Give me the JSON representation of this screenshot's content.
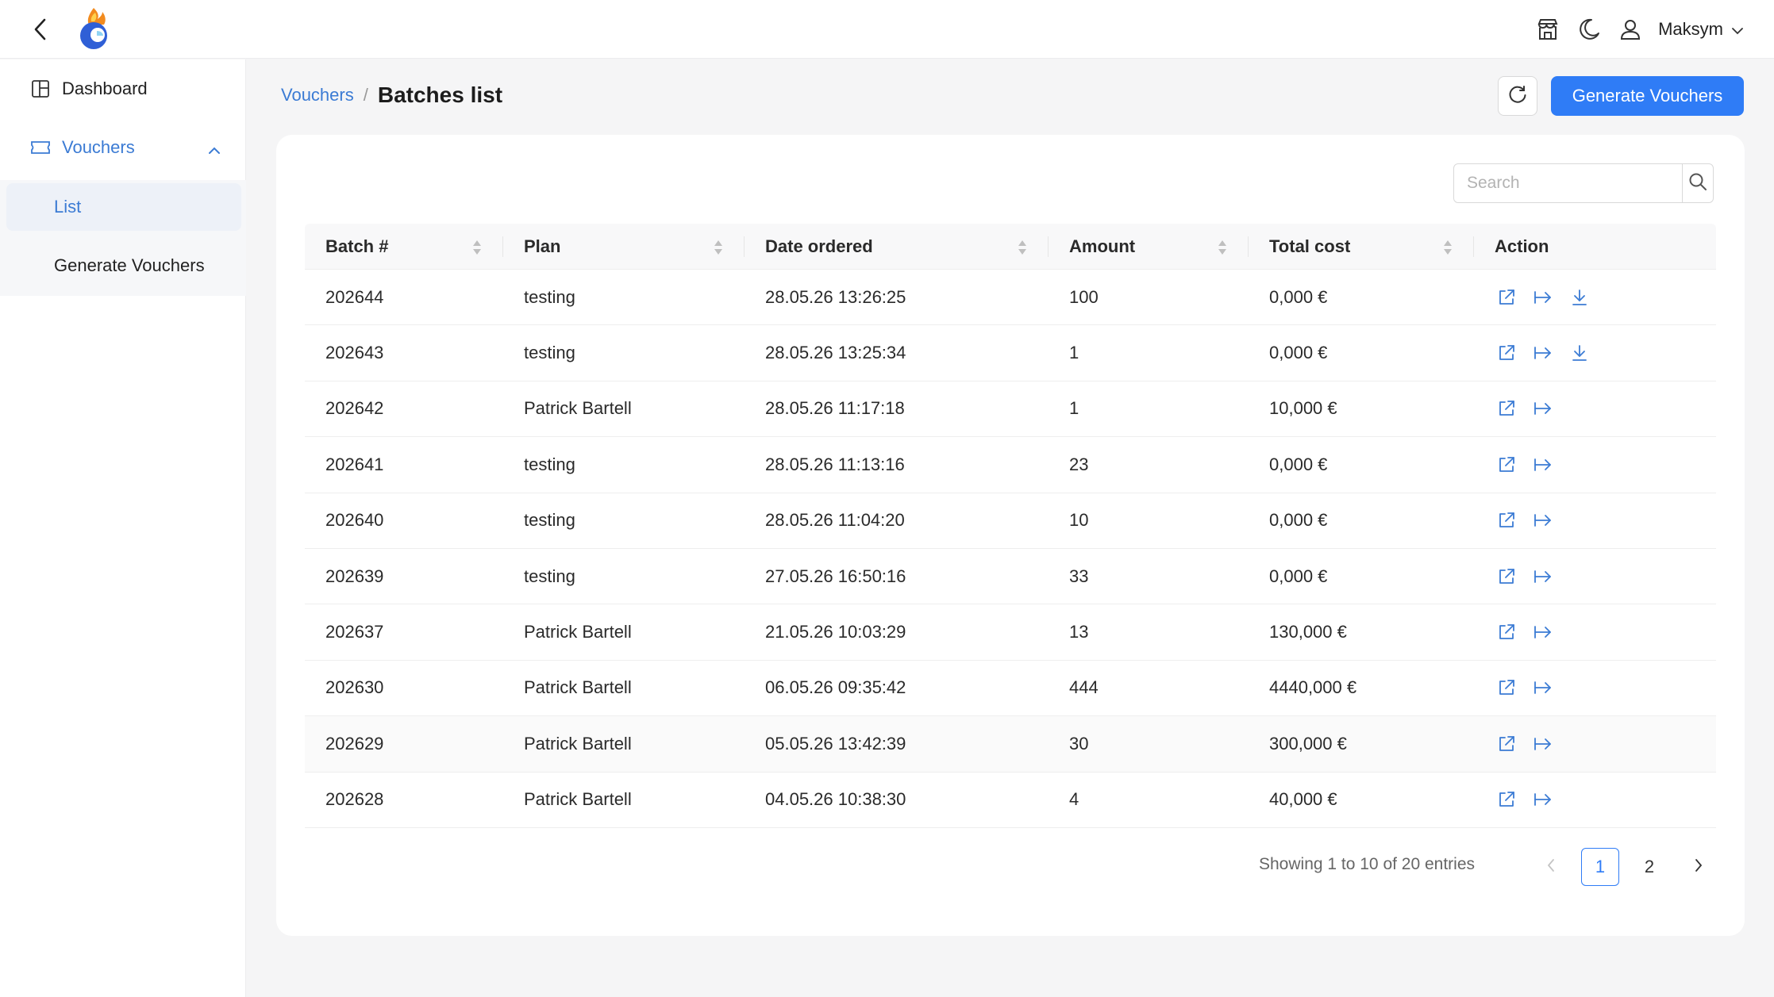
{
  "header": {
    "user_name": "Maksym",
    "icons": [
      "back-arrow-icon",
      "app-logo",
      "store-icon",
      "moon-icon",
      "user-icon",
      "chevron-down-icon"
    ]
  },
  "sidebar": {
    "items": [
      {
        "label": "Dashboard",
        "icon": "dashboard-icon"
      },
      {
        "label": "Vouchers",
        "icon": "ticket-icon",
        "expanded": true
      }
    ],
    "subitems": [
      {
        "label": "List",
        "selected": true
      },
      {
        "label": "Generate Vouchers",
        "selected": false
      }
    ]
  },
  "breadcrumb": {
    "parent": "Vouchers",
    "separator": "/",
    "current": "Batches list"
  },
  "toolbar": {
    "generate_label": "Generate Vouchers"
  },
  "search": {
    "placeholder": "Search",
    "value": ""
  },
  "table": {
    "columns": [
      "Batch #",
      "Plan",
      "Date ordered",
      "Amount",
      "Total cost",
      "Action"
    ],
    "rows": [
      {
        "batch": "202644",
        "plan": "testing",
        "date": "28.05.26 13:26:25",
        "amount": "100",
        "cost": "0,000 €",
        "download": true
      },
      {
        "batch": "202643",
        "plan": "testing",
        "date": "28.05.26 13:25:34",
        "amount": "1",
        "cost": "0,000 €",
        "download": true
      },
      {
        "batch": "202642",
        "plan": "Patrick Bartell",
        "date": "28.05.26 11:17:18",
        "amount": "1",
        "cost": "10,000 €",
        "download": false
      },
      {
        "batch": "202641",
        "plan": "testing",
        "date": "28.05.26 11:13:16",
        "amount": "23",
        "cost": "0,000 €",
        "download": false
      },
      {
        "batch": "202640",
        "plan": "testing",
        "date": "28.05.26 11:04:20",
        "amount": "10",
        "cost": "0,000 €",
        "download": false
      },
      {
        "batch": "202639",
        "plan": "testing",
        "date": "27.05.26 16:50:16",
        "amount": "33",
        "cost": "0,000 €",
        "download": false
      },
      {
        "batch": "202637",
        "plan": "Patrick Bartell",
        "date": "21.05.26 10:03:29",
        "amount": "13",
        "cost": "130,000 €",
        "download": false
      },
      {
        "batch": "202630",
        "plan": "Patrick Bartell",
        "date": "06.05.26 09:35:42",
        "amount": "444",
        "cost": "4440,000 €",
        "download": false
      },
      {
        "batch": "202629",
        "plan": "Patrick Bartell",
        "date": "05.05.26 13:42:39",
        "amount": "30",
        "cost": "300,000 €",
        "download": false
      },
      {
        "batch": "202628",
        "plan": "Patrick Bartell",
        "date": "04.05.26 10:38:30",
        "amount": "4",
        "cost": "40,000 €",
        "download": false
      }
    ]
  },
  "pagination": {
    "info": "Showing 1 to 10 of 20 entries",
    "pages": [
      "1",
      "2"
    ],
    "current": "1"
  },
  "colors": {
    "accent": "#2f7cf6",
    "link": "#3b7bd4"
  }
}
